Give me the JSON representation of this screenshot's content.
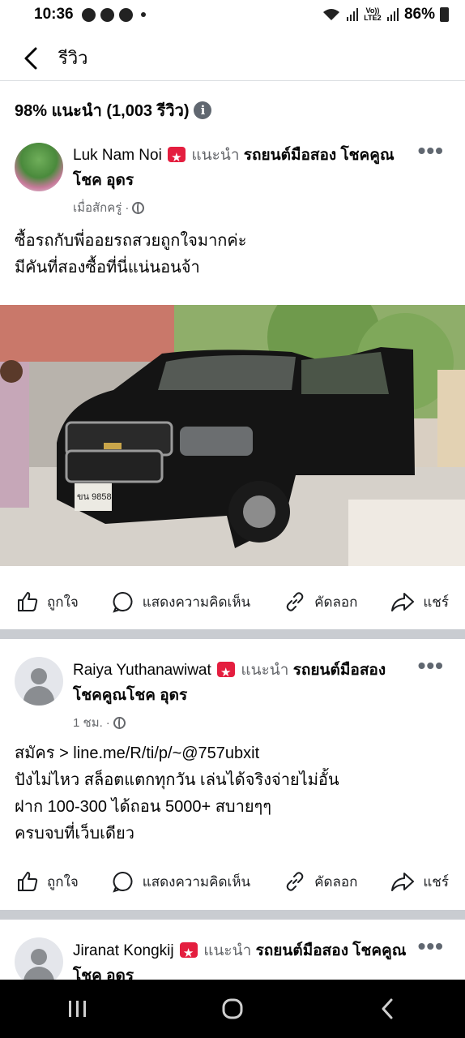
{
  "status_bar": {
    "time": "10:36",
    "network_label": "Vo)) LTE2",
    "battery": "86%"
  },
  "header": {
    "title": "รีวิว"
  },
  "summary": {
    "text": "98% แนะนำ (1,003 รีวิว)",
    "info_icon": "i"
  },
  "reviews": [
    {
      "name": "Luk Nam Noi",
      "recommends": "แนะนำ",
      "page": "รถยนต์มือสอง โชคคูณโชค อุดร",
      "time": "เมื่อสักครู่",
      "text": "ซื้อรถกับพี่ออยรถสวยถูกใจมากค่ะ\nมีคันที่สองซื้อที่นี่แน่นอนจ้า",
      "plate": "ขน 9858"
    },
    {
      "name": "Raiya Yuthanawiwat",
      "recommends": "แนะนำ",
      "page": "รถยนต์มือสอง โชคคูณโชค อุดร",
      "time": "1 ชม.",
      "text": "สมัคร > line.me/R/ti/p/~@757ubxit\nปังไม่ไหว สล็อตแตกทุกวัน เล่นได้จริงจ่ายไม่อั้น\nฝาก 100-300 ได้ถอน 5000+ สบายๆๆ\nครบจบที่เว็บเดียว"
    },
    {
      "name": "Jiranat Kongkij",
      "recommends": "แนะนำ",
      "page": "รถยนต์มือสอง โชคคูณโชค อุดร"
    }
  ],
  "actions": {
    "like": "ถูกใจ",
    "comment": "แสดงความคิดเห็น",
    "copy": "คัดลอก",
    "share": "แชร์"
  },
  "icons": {
    "back": "chevron-left-icon",
    "more": "more-horizontal-icon",
    "like": "thumbs-up-icon",
    "comment": "comment-bubble-icon",
    "copy": "link-icon",
    "share": "share-arrow-icon",
    "globe": "globe-icon"
  },
  "colors": {
    "recommend_badge": "#e41e3f",
    "muted_text": "#65676b",
    "separator": "#c9ccd1"
  }
}
